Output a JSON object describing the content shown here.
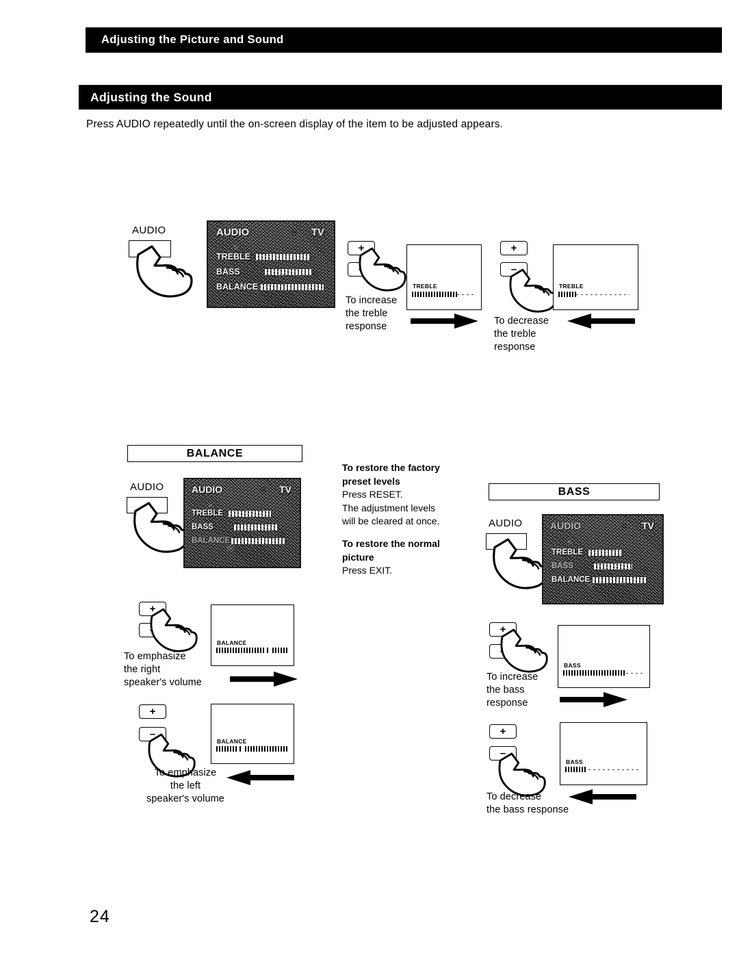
{
  "header": {
    "chapter_title": "Adjusting the Picture and Sound",
    "section_title": "Adjusting the Sound"
  },
  "intro": "Press AUDIO repeatedly until the on-screen display of the item to be adjusted appears.",
  "page_number": "24",
  "osd_menu": {
    "title_left": "AUDIO",
    "title_right": "TV",
    "rows": [
      "TREBLE",
      "BASS",
      "BALANCE"
    ]
  },
  "buttons": {
    "audio": "AUDIO",
    "plus": "+",
    "minus": "–"
  },
  "treble_block": {
    "increase_caption": [
      "To increase",
      "the treble",
      "response"
    ],
    "decrease_caption": [
      "To decrease",
      "the treble",
      "response"
    ],
    "screen_label": "TREBLE"
  },
  "balance_block": {
    "box_title": "BALANCE",
    "right_caption": [
      "To emphasize",
      "the right",
      "speaker's volume"
    ],
    "left_caption": [
      "To emphasize",
      "the left",
      "speaker's volume"
    ],
    "screen_label": "BALANCE"
  },
  "bass_block": {
    "box_title": "BASS",
    "increase_caption": [
      "To increase",
      "the bass",
      "response"
    ],
    "decrease_caption": [
      "To decrease",
      "the bass response"
    ],
    "screen_label": "BASS"
  },
  "notes": {
    "restore_factory_heading": [
      "To restore the factory",
      "preset levels"
    ],
    "restore_factory_body": [
      "Press RESET.",
      "The adjustment levels",
      "will be cleared at once."
    ],
    "restore_picture_heading": [
      "To restore the normal",
      "picture"
    ],
    "restore_picture_body": [
      "Press EXIT."
    ]
  },
  "colors": {
    "bar_background": "#000000",
    "bar_text": "#ffffff",
    "page_background": "#ffffff"
  }
}
